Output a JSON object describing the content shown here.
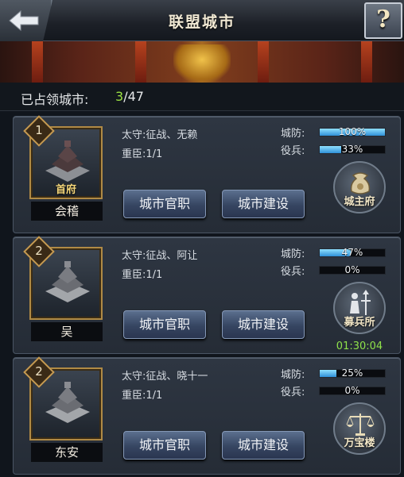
{
  "header": {
    "title": "联盟城市"
  },
  "occupied": {
    "label": "已占领城市:",
    "current": "3",
    "total": "/47"
  },
  "cities": [
    {
      "level": "1",
      "name": "会稽",
      "seat_label": "首府",
      "lord": "太守:征战、无赖",
      "minister": "重臣:1/1",
      "defense_label": "城防:",
      "defense_text": "100%",
      "defense_value": 1.0,
      "troops_label": "役兵:",
      "troops_text": "33%",
      "troops_value": 0.33,
      "officials_btn": "城市官职",
      "build_btn": "城市建设",
      "building_label": "城主府",
      "building_icon": "money-bag-icon",
      "timer": ""
    },
    {
      "level": "2",
      "name": "吴",
      "seat_label": "",
      "lord": "太守:征战、阿让",
      "minister": "重臣:1/1",
      "defense_label": "城防:",
      "defense_text": "47%",
      "defense_value": 0.47,
      "troops_label": "役兵:",
      "troops_text": "0%",
      "troops_value": 0.0,
      "officials_btn": "城市官职",
      "build_btn": "城市建设",
      "building_label": "募兵所",
      "building_icon": "recruit-icon",
      "timer": "01:30:04"
    },
    {
      "level": "2",
      "name": "东安",
      "seat_label": "",
      "lord": "太守:征战、晓十一",
      "minister": "重臣:1/1",
      "defense_label": "城防:",
      "defense_text": "25%",
      "defense_value": 0.25,
      "troops_label": "役兵:",
      "troops_text": "0%",
      "troops_value": 0.0,
      "officials_btn": "城市官职",
      "build_btn": "城市建设",
      "building_label": "万宝楼",
      "building_icon": "scales-icon",
      "timer": ""
    }
  ],
  "colors": {
    "accent_green": "#9ae042",
    "bar_blue": "#2f90d8",
    "gold": "#b08a45"
  }
}
